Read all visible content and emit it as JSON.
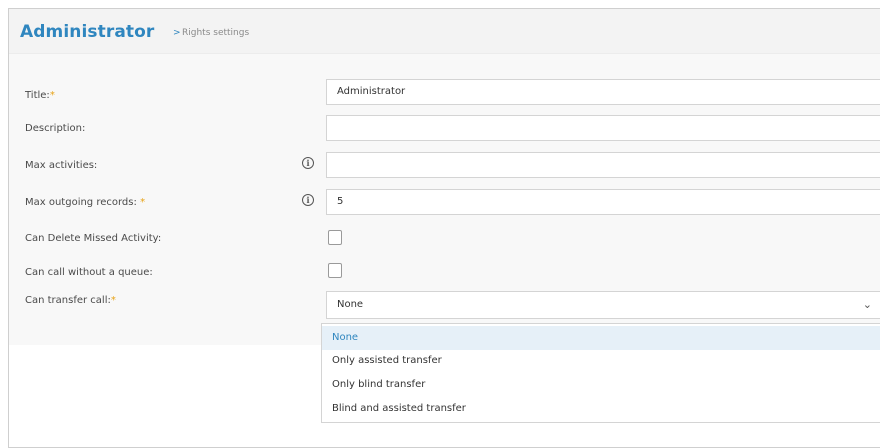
{
  "header": {
    "title": "Administrator",
    "separator": ">",
    "subtitle": "Rights settings"
  },
  "form": {
    "required_mark": "*",
    "title_label": "Title:",
    "title_value": "Administrator",
    "description_label": "Description:",
    "description_value": "",
    "max_activities_label": "Max activities:",
    "max_activities_value": "",
    "max_outgoing_label": "Max outgoing records:",
    "max_outgoing_value": "5",
    "can_delete_missed_label": "Can Delete Missed Activity:",
    "can_delete_missed_checked": false,
    "can_call_no_queue_label": "Can call without a queue:",
    "can_call_no_queue_checked": false,
    "can_transfer_label": "Can transfer call:",
    "can_transfer_value": "None"
  },
  "icons": {
    "info": "info-icon",
    "chevron": "chevron-down-icon"
  },
  "dropdown": {
    "options": [
      "None",
      "Only assisted transfer",
      "Only blind transfer",
      "Blind and assisted transfer"
    ],
    "selected_index": 0
  },
  "colors": {
    "accent": "#2f86bf",
    "required": "#e8a317"
  }
}
